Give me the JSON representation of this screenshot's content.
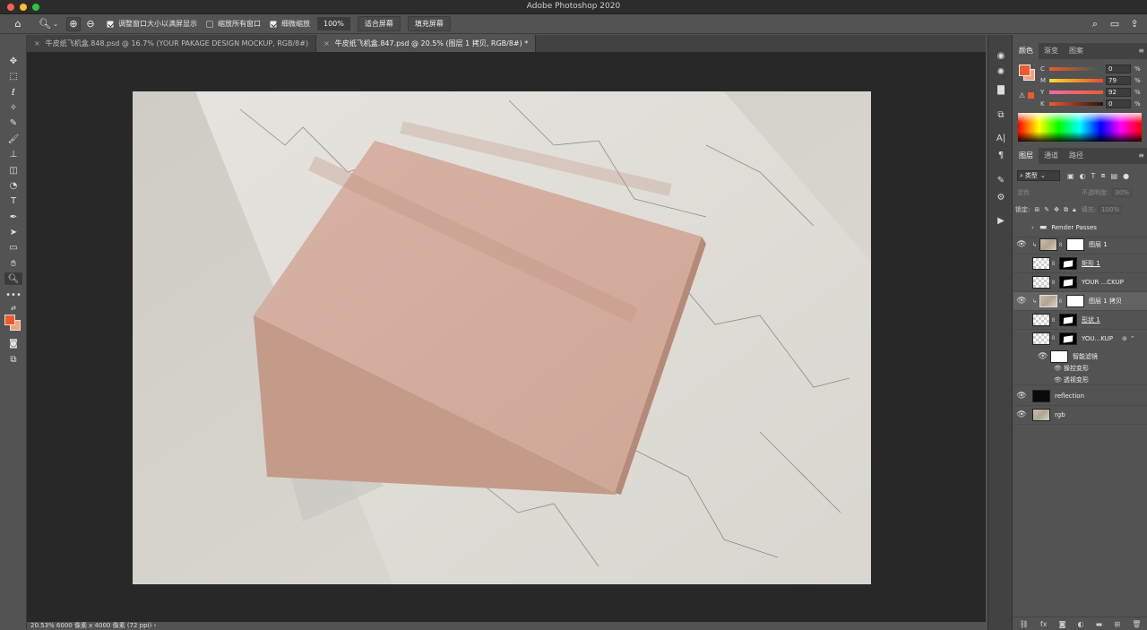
{
  "window": {
    "title": "Adobe Photoshop 2020",
    "lights": [
      "#ff5f57",
      "#febc2e",
      "#28c840"
    ]
  },
  "options_bar": {
    "resize_windows": "调整窗口大小以满屏显示",
    "zoom_all": "缩放所有窗口",
    "scrubby_zoom": "细微缩放",
    "zoom_value": "100%",
    "fit_screen": "适合屏幕",
    "fill_screen": "填充屏幕"
  },
  "tabs": [
    {
      "label": "牛皮纸飞机盒.848.psd @ 16.7% (YOUR PAKAGE DESIGN MOCKUP, RGB/8#)",
      "close": "×"
    },
    {
      "label": "牛皮纸飞机盒.847.psd @ 20.5% (图层 1 拷贝, RGB/8#) *",
      "close": "×"
    }
  ],
  "status_bar": {
    "text": "20.53%    6000 像素 x 4000 像素 (72 ppi)    ›"
  },
  "color_panel": {
    "tabs": [
      "颜色",
      "渐变",
      "图案"
    ],
    "foreground": "#f05a2b",
    "background": "#f3a280",
    "channels": [
      {
        "label": "C",
        "value": "0",
        "pct": "%"
      },
      {
        "label": "M",
        "value": "79",
        "pct": "%"
      },
      {
        "label": "Y",
        "value": "92",
        "pct": "%"
      },
      {
        "label": "K",
        "value": "0",
        "pct": "%"
      }
    ]
  },
  "layers_panel": {
    "tabs": [
      "图层",
      "通道",
      "路径"
    ],
    "filter_kind": "类型",
    "blend_mode": "滤色",
    "opacity_label": "不透明度:",
    "opacity_value": "30%",
    "lock_label": "锁定:",
    "fill_label": "填充:",
    "fill_value": "100%",
    "layers": [
      {
        "name": "Render Passes"
      },
      {
        "name": "图层 1"
      },
      {
        "name": "矩形 1"
      },
      {
        "name": "YOUR ...CKUP"
      },
      {
        "name": "图层 1 拷贝"
      },
      {
        "name": "形状 1"
      },
      {
        "name": "YOU...KUP"
      },
      {
        "name": "智能滤镜"
      },
      {
        "name": "操控变形"
      },
      {
        "name": "透视变形"
      },
      {
        "name": "reflection"
      },
      {
        "name": "rgb"
      }
    ]
  }
}
